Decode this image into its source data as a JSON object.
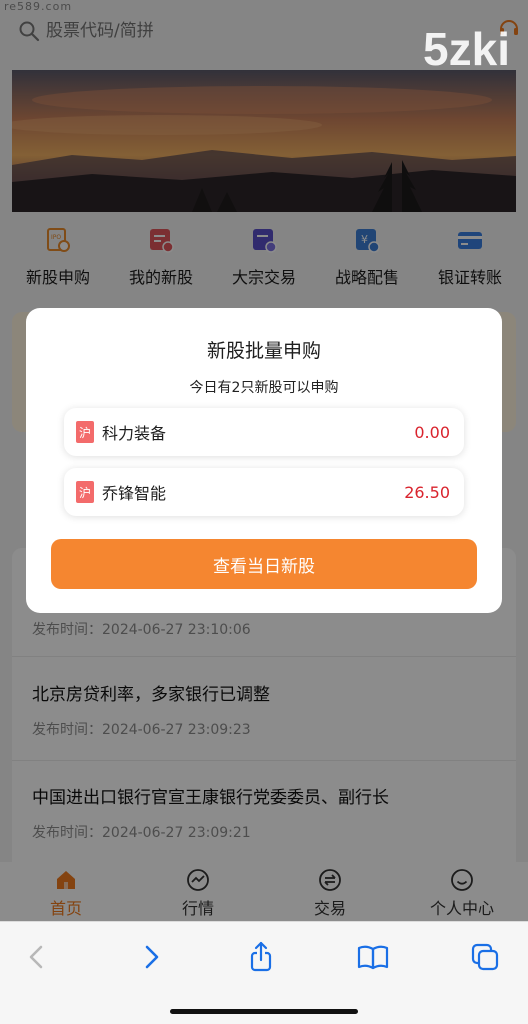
{
  "watermark": "re589.com",
  "brand": "5zki",
  "search": {
    "placeholder": "股票代码/简拼"
  },
  "quick_menu": [
    {
      "label": "新股申购",
      "icon": "ipo-icon"
    },
    {
      "label": "我的新股",
      "icon": "my-ipo-icon"
    },
    {
      "label": "大宗交易",
      "icon": "block-trade-icon"
    },
    {
      "label": "战略配售",
      "icon": "strategic-placement-icon"
    },
    {
      "label": "银证转账",
      "icon": "bank-transfer-icon"
    }
  ],
  "news": [
    {
      "title": "",
      "time": "发布时间：2024-06-27 23:10:06"
    },
    {
      "title": "北京房贷利率，多家银行已调整",
      "time": "发布时间：2024-06-27 23:09:23"
    },
    {
      "title": "中国进出口银行官宣王康银行党委委员、副行长",
      "time": "发布时间：2024-06-27 23:09:21"
    }
  ],
  "tabbar": [
    {
      "label": "首页",
      "icon": "home-icon",
      "active": true
    },
    {
      "label": "行情",
      "icon": "market-icon",
      "active": false
    },
    {
      "label": "交易",
      "icon": "trade-icon",
      "active": false
    },
    {
      "label": "个人中心",
      "icon": "profile-icon",
      "active": false
    }
  ],
  "modal": {
    "title": "新股批量申购",
    "subtitle": "今日有2只新股可以申购",
    "items": [
      {
        "market": "沪",
        "name": "科力装备",
        "price": "0.00"
      },
      {
        "market": "沪",
        "name": "乔锋智能",
        "price": "26.50"
      }
    ],
    "button_label": "查看当日新股"
  },
  "colors": {
    "accent": "#f58630",
    "price": "#d9232d",
    "market_tag": "#f36b6b",
    "active_tab": "#f07b1e"
  }
}
